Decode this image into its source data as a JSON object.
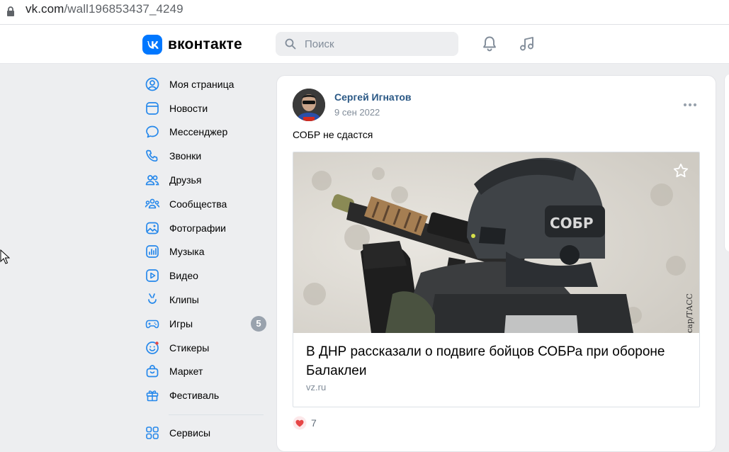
{
  "browser": {
    "url": "vk.com/wall196853437_4249"
  },
  "header": {
    "logo_text": "вконтакте",
    "search_placeholder": "Поиск",
    "brand_color": "#0077ff"
  },
  "sidebar": {
    "items": [
      {
        "label": "Моя страница",
        "icon": "user-circle-icon"
      },
      {
        "label": "Новости",
        "icon": "news-icon"
      },
      {
        "label": "Мессенджер",
        "icon": "message-icon"
      },
      {
        "label": "Звонки",
        "icon": "phone-icon"
      },
      {
        "label": "Друзья",
        "icon": "friends-icon"
      },
      {
        "label": "Сообщества",
        "icon": "communities-icon"
      },
      {
        "label": "Фотографии",
        "icon": "photo-icon"
      },
      {
        "label": "Музыка",
        "icon": "music-icon"
      },
      {
        "label": "Видео",
        "icon": "video-icon"
      },
      {
        "label": "Клипы",
        "icon": "clips-icon"
      },
      {
        "label": "Игры",
        "icon": "gamepad-icon",
        "badge": "5"
      },
      {
        "label": "Стикеры",
        "icon": "sticker-icon"
      },
      {
        "label": "Маркет",
        "icon": "market-icon"
      },
      {
        "label": "Фестиваль",
        "icon": "gift-icon"
      }
    ],
    "services_label": "Сервисы"
  },
  "post": {
    "author": "Сергей Игнатов",
    "date": "9 сен 2022",
    "text": "СОБР не сдастся",
    "snippet": {
      "title": "В ДНР рассказали о подвиге бойцов СОБРа при обороне Балаклеи",
      "domain": "vz.ru",
      "image_caption": "СОБР",
      "credit": "сар/ТАСС"
    },
    "likes": "7"
  }
}
